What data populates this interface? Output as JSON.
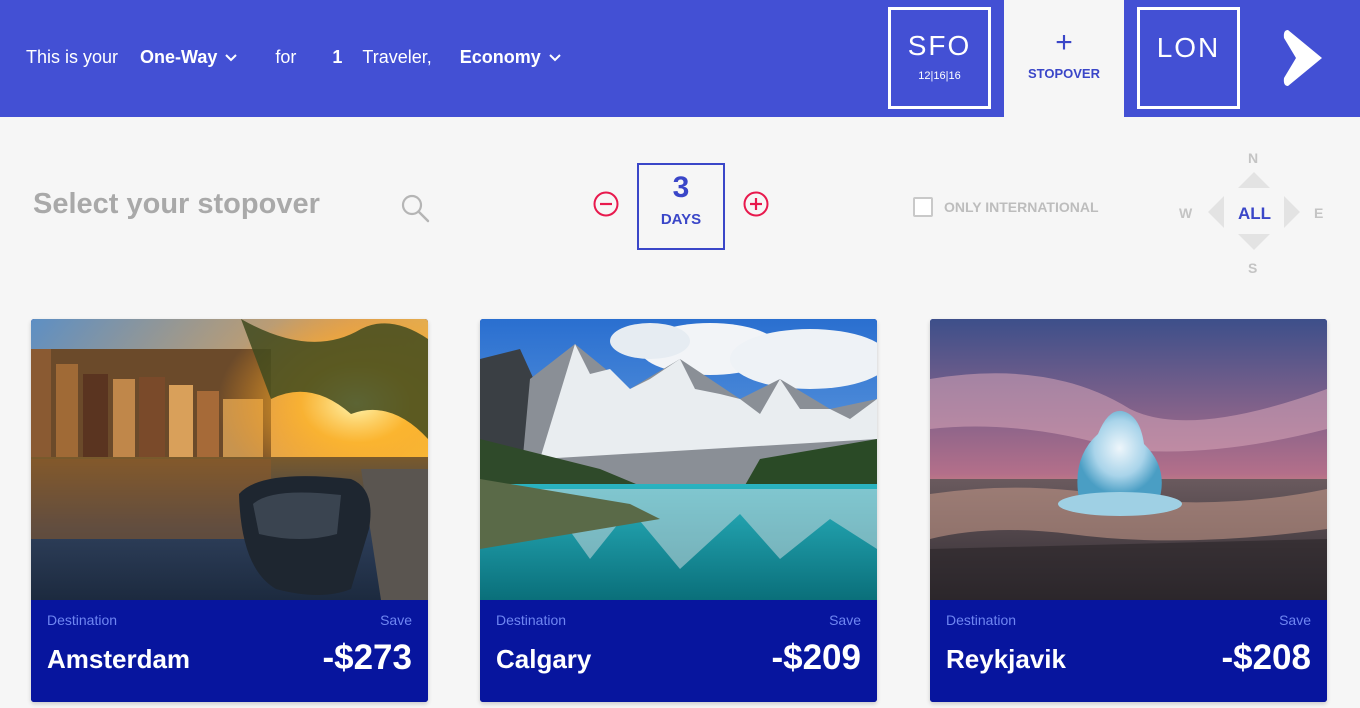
{
  "header": {
    "prefix": "This is your",
    "trip_type": "One-Way",
    "for_text": "for",
    "traveler_count": "1",
    "traveler_text": "Traveler,",
    "cabin": "Economy",
    "origin": {
      "code": "SFO",
      "date": "12|16|16"
    },
    "stopover": {
      "plus": "+",
      "label": "STOPOVER"
    },
    "destination": {
      "code": "LON"
    },
    "accent_color": "#4350d4"
  },
  "filters": {
    "title": "Select your stopover",
    "days_value": "3",
    "days_unit": "DAYS",
    "only_international": "ONLY INTERNATIONAL",
    "compass": {
      "n": "N",
      "s": "S",
      "w": "W",
      "e": "E",
      "all": "ALL"
    }
  },
  "cards": [
    {
      "label": "Destination",
      "save_label": "Save",
      "city": "Amsterdam",
      "price": "-$273"
    },
    {
      "label": "Destination",
      "save_label": "Save",
      "city": "Calgary",
      "price": "-$209"
    },
    {
      "label": "Destination",
      "save_label": "Save",
      "city": "Reykjavik",
      "price": "-$208"
    }
  ],
  "colors": {
    "card_footer": "#07159e",
    "increment_red": "#e8194d",
    "brand_blue": "#3a46c8"
  }
}
